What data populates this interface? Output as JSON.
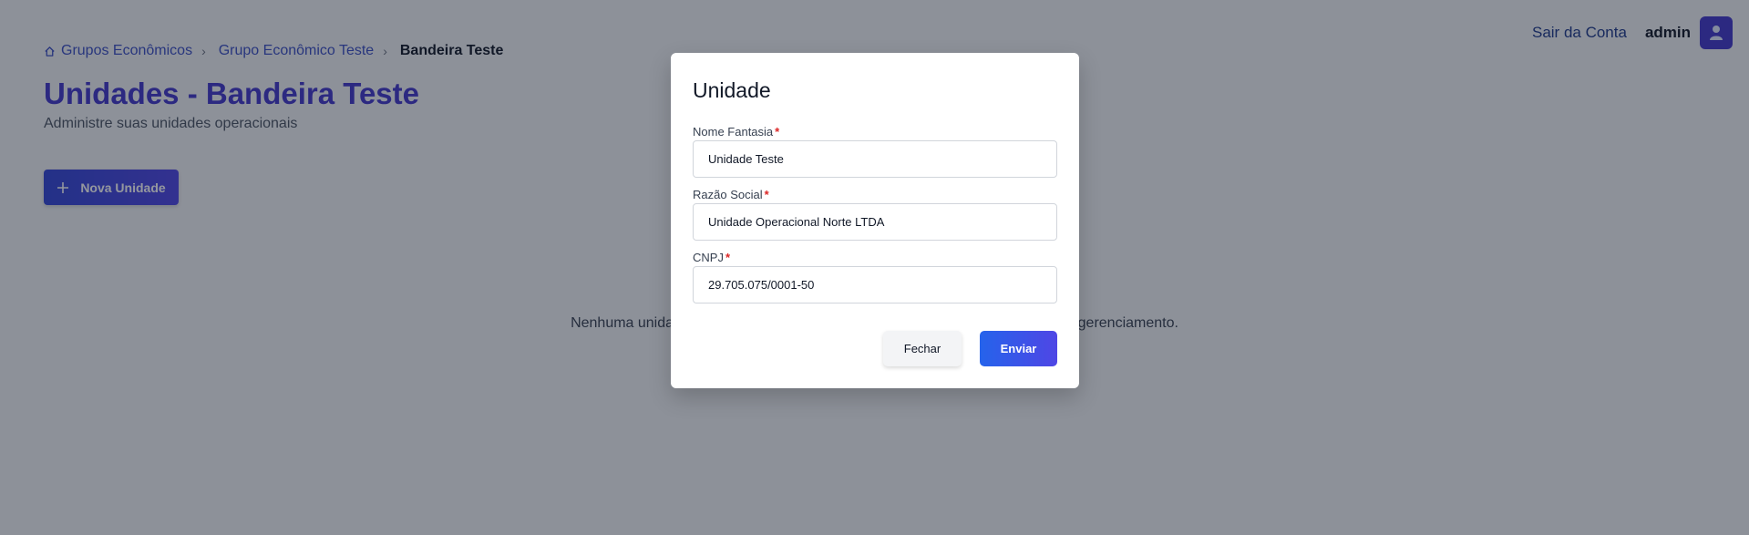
{
  "header": {
    "logout_label": "Sair da Conta",
    "user_name": "admin",
    "avatar_icon": "user-icon"
  },
  "breadcrumb": {
    "home_icon": "home-icon",
    "items": [
      "Grupos Econômicos",
      "Grupo Econômico Teste"
    ],
    "current": "Bandeira Teste"
  },
  "page": {
    "title": "Unidades - Bandeira Teste",
    "subtitle": "Administre suas unidades operacionais",
    "new_button_label": "Nova Unidade",
    "empty_message": "Nenhuma unidade cadastrada ainda. Clique em \"Nova Unidade\" para iniciar o gerenciamento."
  },
  "modal": {
    "title": "Unidade",
    "fields": [
      {
        "label": "Nome Fantasia",
        "required_mark": "*",
        "value": "Unidade Teste"
      },
      {
        "label": "Razão Social",
        "required_mark": "*",
        "value": "Unidade Operacional Norte LTDA"
      },
      {
        "label": "CNPJ",
        "required_mark": "*",
        "value": "29.705.075/0001-50"
      }
    ],
    "close_label": "Fechar",
    "submit_label": "Enviar"
  },
  "colors": {
    "accent": "#4338ca",
    "link": "#3b4fc4",
    "required": "#dc2626"
  }
}
